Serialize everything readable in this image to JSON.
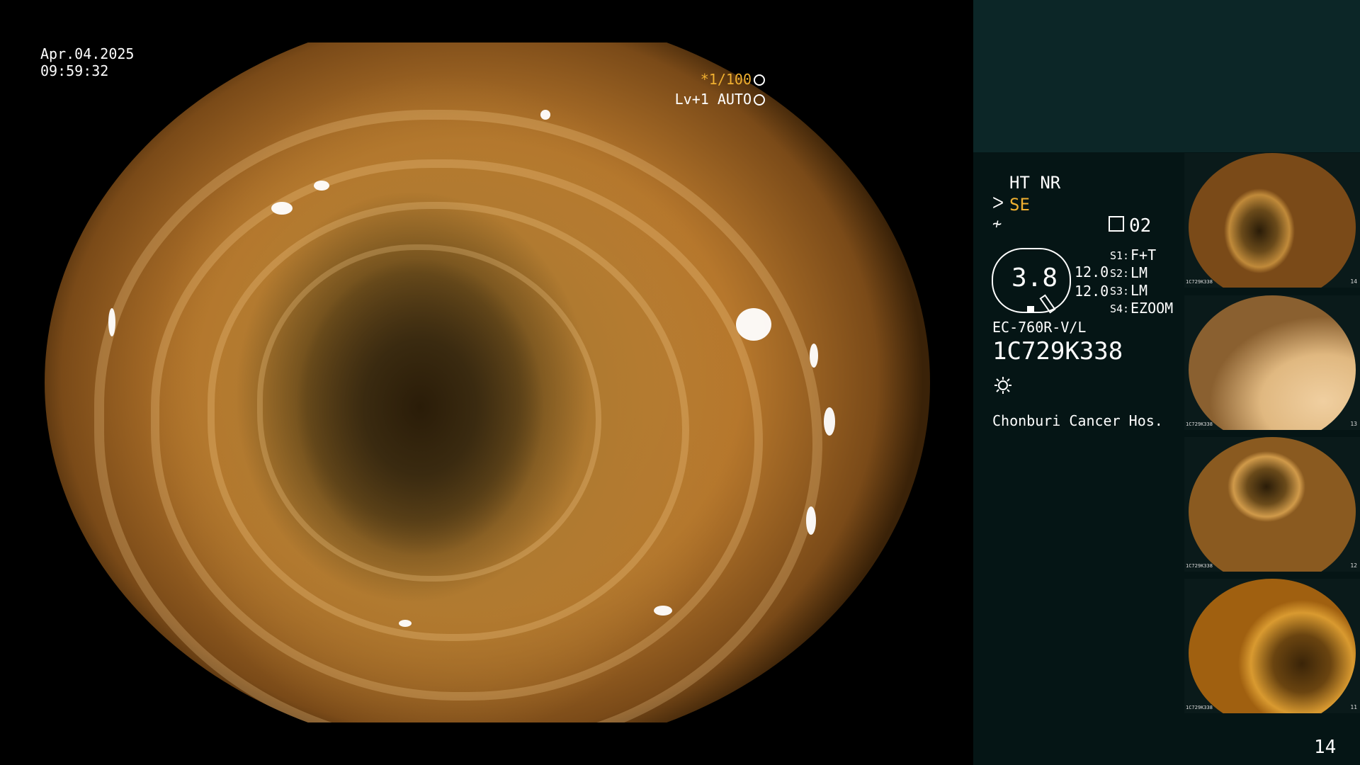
{
  "osd": {
    "date": "Apr.04.2025",
    "time": "09:59:32",
    "shutter": "*1/100",
    "level": "Lv+1 AUTO"
  },
  "panel": {
    "mode": "HT NR",
    "enhance": "SE",
    "record_count": "02",
    "zoom_value": "3.8",
    "value_1": "12.0",
    "value_2": "12.0",
    "switches": [
      {
        "label": "S1:",
        "value": "F+T"
      },
      {
        "label": "S2:",
        "value": "LM"
      },
      {
        "label": "S3:",
        "value": "LM"
      },
      {
        "label": "S4:",
        "value": "EZOOM"
      }
    ],
    "scope_model": "EC-760R-V/L",
    "serial": "1C729K338",
    "hospital": "Chonburi Cancer Hos."
  },
  "thumbnails": [
    {
      "serial": "1C729K338",
      "num": "14"
    },
    {
      "serial": "1C729K338",
      "num": "13"
    },
    {
      "serial": "1C729K338",
      "num": "12"
    },
    {
      "serial": "1C729K338",
      "num": "11"
    }
  ],
  "page_number": "14",
  "colors": {
    "accent": "#f0b030",
    "panel_top": "#0c2627",
    "panel": "#051515"
  }
}
